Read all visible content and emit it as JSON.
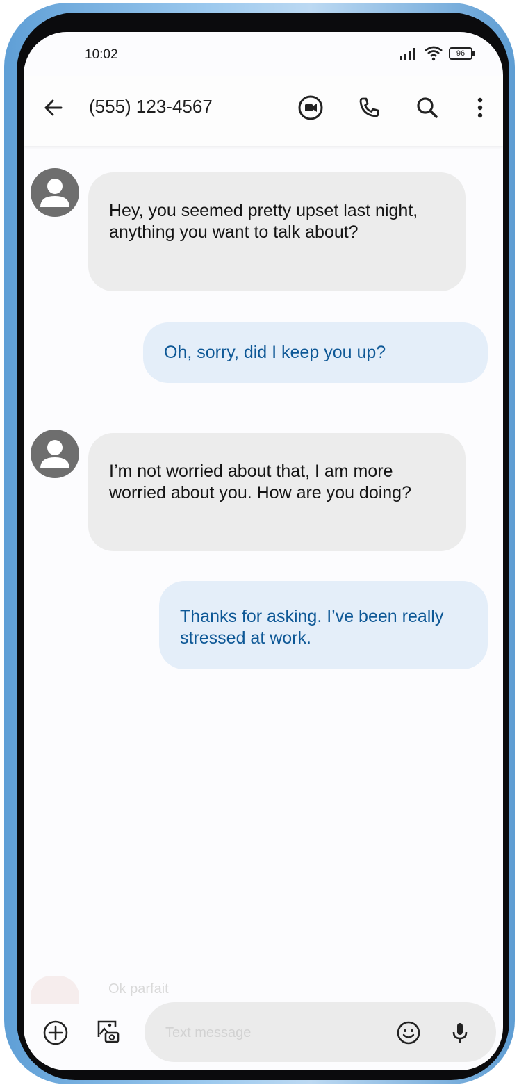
{
  "status_bar": {
    "time": "10:02",
    "battery": "96"
  },
  "app_bar": {
    "contact": "(555) 123-4567"
  },
  "messages": [
    {
      "direction": "incoming",
      "text": "Hey, you seemed pretty upset last night, anything you want to talk about?"
    },
    {
      "direction": "outgoing",
      "text": "Oh, sorry, did I keep you up?"
    },
    {
      "direction": "incoming",
      "text": "I’m not worried about that, I am more worried about you. How are you doing?"
    },
    {
      "direction": "outgoing",
      "text": "Thanks for asking. I’ve been really stressed at work."
    }
  ],
  "composer": {
    "ghost_preview": "Ok parfait",
    "placeholder": "Text message"
  },
  "colors": {
    "incoming_bubble": "#ececec",
    "outgoing_bubble": "#e4eef9",
    "outgoing_text": "#0e5896",
    "avatar": "#6e6e6e",
    "frame_accent": "#5f9fd6"
  },
  "icons": [
    "back-arrow-icon",
    "video-call-icon",
    "phone-icon",
    "search-icon",
    "more-vert-icon",
    "add-circle-icon",
    "gallery-icon",
    "emoji-icon",
    "mic-icon",
    "signal-icon",
    "wifi-icon",
    "battery-icon",
    "person-icon"
  ]
}
